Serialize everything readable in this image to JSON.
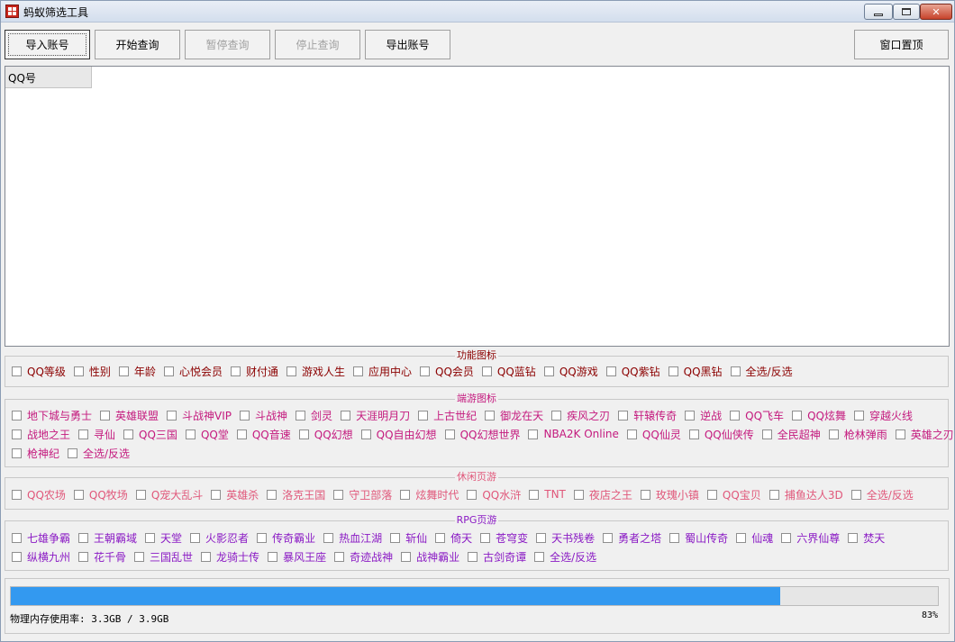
{
  "window": {
    "title": "蚂蚁筛选工具"
  },
  "toolbar": {
    "import_label": "导入账号",
    "start_label": "开始查询",
    "pause_label": "暂停查询",
    "stop_label": "停止查询",
    "export_label": "导出账号",
    "pin_label": "窗口置顶"
  },
  "table": {
    "columns": [
      "QQ号"
    ]
  },
  "groups": {
    "func": {
      "title": "功能图标",
      "color": "#8b0000",
      "rows": [
        [
          "QQ等级",
          "性别",
          "年龄",
          "心悦会员",
          "财付通",
          "游戏人生",
          "应用中心",
          "QQ会员",
          "QQ蓝钻",
          "QQ游戏",
          "QQ紫钻",
          "QQ黑钻",
          "全选/反选"
        ]
      ]
    },
    "client": {
      "title": "端游图标",
      "color": "#c41a7e",
      "rows": [
        [
          "地下城与勇士",
          "英雄联盟",
          "斗战神VIP",
          "斗战神",
          "剑灵",
          "天涯明月刀",
          "上古世纪",
          "御龙在天",
          "疾风之刃",
          "轩辕传奇",
          "逆战",
          "QQ飞车",
          "QQ炫舞",
          "穿越火线"
        ],
        [
          "战地之王",
          "寻仙",
          "QQ三国",
          "QQ堂",
          "QQ音速",
          "QQ幻想",
          "QQ自由幻想",
          "QQ幻想世界",
          "NBA2K Online",
          "QQ仙灵",
          "QQ仙侠传",
          "全民超神",
          "枪林弹雨",
          "英雄之刃"
        ],
        [
          "枪神纪",
          "全选/反选"
        ]
      ]
    },
    "casual": {
      "title": "休闲页游",
      "color": "#e0577a",
      "rows": [
        [
          "QQ农场",
          "QQ牧场",
          "Q宠大乱斗",
          "英雄杀",
          "洛克王国",
          "守卫部落",
          "炫舞时代",
          "QQ水浒",
          "TNT",
          "夜店之王",
          "玫瑰小镇",
          "QQ宝贝",
          "捕鱼达人3D",
          "全选/反选"
        ]
      ]
    },
    "rpg": {
      "title": "RPG页游",
      "color": "#8a1ac4",
      "rows": [
        [
          "七雄争霸",
          "王朝霸域",
          "天堂",
          "火影忍者",
          "传奇霸业",
          "热血江湖",
          "斩仙",
          "倚天",
          "苍穹变",
          "天书残卷",
          "勇者之塔",
          "蜀山传奇",
          "仙魂",
          "六界仙尊",
          "焚天"
        ],
        [
          "纵横九州",
          "花千骨",
          "三国乱世",
          "龙骑士传",
          "暴风王座",
          "奇迹战神",
          "战神霸业",
          "古剑奇谭",
          "全选/反选"
        ]
      ]
    }
  },
  "status": {
    "memory_text": "物理内存使用率: 3.3GB / 3.9GB",
    "percent_text": "83%",
    "progress": 0.83
  }
}
